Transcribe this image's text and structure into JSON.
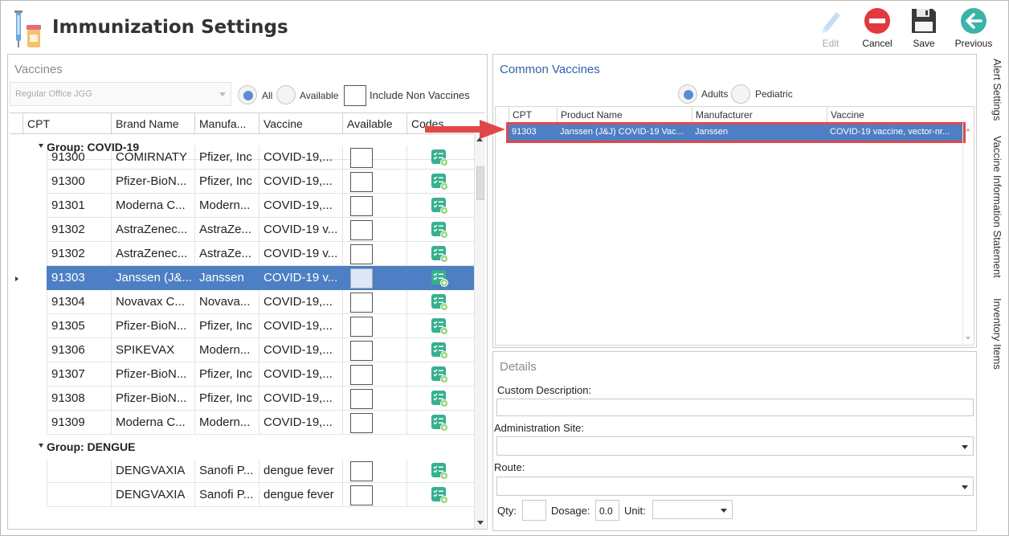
{
  "header": {
    "title": "Immunization Settings"
  },
  "toolbar": {
    "edit": "Edit",
    "cancel": "Cancel",
    "save": "Save",
    "previous": "Previous"
  },
  "vaccines": {
    "title": "Vaccines",
    "combo_value": "Regular Office JGG",
    "filter_all": "All",
    "filter_available": "Available",
    "include_non_vaccines": "Include Non Vaccines",
    "columns": [
      "CPT",
      "Brand Name",
      "Manufa...",
      "Vaccine",
      "Available",
      "Codes"
    ],
    "groups": [
      {
        "label": "Group: COVID-19",
        "rows": [
          {
            "cpt": "",
            "brand": "",
            "mfr": "",
            "vaccine": ""
          },
          {
            "cpt": "91300",
            "brand": "COMIRNATY",
            "mfr": "Pfizer, Inc",
            "vaccine": "COVID-19,..."
          },
          {
            "cpt": "91300",
            "brand": "Pfizer-BioN...",
            "mfr": "Pfizer, Inc",
            "vaccine": "COVID-19,..."
          },
          {
            "cpt": "91301",
            "brand": "Moderna C...",
            "mfr": "Modern...",
            "vaccine": "COVID-19,..."
          },
          {
            "cpt": "91302",
            "brand": "AstraZenec...",
            "mfr": "AstraZe...",
            "vaccine": "COVID-19 v..."
          },
          {
            "cpt": "91302",
            "brand": "AstraZenec...",
            "mfr": "AstraZe...",
            "vaccine": "COVID-19 v..."
          },
          {
            "cpt": "91303",
            "brand": "Janssen (J&...",
            "mfr": "Janssen",
            "vaccine": "COVID-19 v...",
            "selected": true
          },
          {
            "cpt": "91304",
            "brand": "Novavax C...",
            "mfr": "Novava...",
            "vaccine": "COVID-19,..."
          },
          {
            "cpt": "91305",
            "brand": "Pfizer-BioN...",
            "mfr": "Pfizer, Inc",
            "vaccine": "COVID-19,..."
          },
          {
            "cpt": "91306",
            "brand": "SPIKEVAX",
            "mfr": "Modern...",
            "vaccine": "COVID-19,..."
          },
          {
            "cpt": "91307",
            "brand": "Pfizer-BioN...",
            "mfr": "Pfizer, Inc",
            "vaccine": "COVID-19,..."
          },
          {
            "cpt": "91308",
            "brand": "Pfizer-BioN...",
            "mfr": "Pfizer, Inc",
            "vaccine": "COVID-19,..."
          },
          {
            "cpt": "91309",
            "brand": "Moderna C...",
            "mfr": "Modern...",
            "vaccine": "COVID-19,..."
          }
        ]
      },
      {
        "label": "Group: DENGUE",
        "rows": [
          {
            "cpt": "",
            "brand": "DENGVAXIA",
            "mfr": "Sanofi P...",
            "vaccine": "dengue fever"
          },
          {
            "cpt": "",
            "brand": "DENGVAXIA",
            "mfr": "Sanofi P...",
            "vaccine": "dengue fever"
          }
        ]
      }
    ]
  },
  "common": {
    "title": "Common Vaccines",
    "adults": "Adults",
    "pediatric": "Pediatric",
    "columns": [
      "CPT",
      "Product Name",
      "Manufacturer",
      "Vaccine"
    ],
    "row": {
      "cpt": "91303",
      "product": "Janssen (J&J) COVID-19 Vac...",
      "mfr": "Janssen",
      "vaccine": "COVID-19 vaccine, vector-nr..."
    }
  },
  "details": {
    "title": "Details",
    "custom_description": "Custom Description:",
    "administration_site": "Administration Site:",
    "route": "Route:",
    "qty": "Qty:",
    "dosage": "Dosage:",
    "dosage_value": "0.0",
    "unit": "Unit:"
  },
  "side_tabs": [
    "Alert Settings",
    "Vaccine Information Statement",
    "Inventory Items"
  ],
  "colors": {
    "selection": "#4e7fc4",
    "accent_blue": "#2f62a8",
    "cancel_red": "#e0393e",
    "previous_teal": "#3bb3a8",
    "callout_red": "#e04848"
  }
}
